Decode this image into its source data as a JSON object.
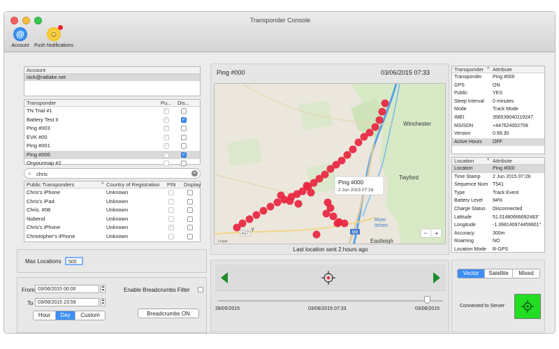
{
  "window": {
    "title": "Transponder Console"
  },
  "toolbar": {
    "account_label": "Account",
    "push_label": "Push Notifications"
  },
  "account": {
    "header": "Account",
    "email": "nick@ratlake.net"
  },
  "transponders": {
    "headers": [
      "Transponder",
      "Pu...",
      "Dis..."
    ],
    "rows": [
      {
        "name": "TN Trial #1",
        "public": true,
        "display": false
      },
      {
        "name": "Battery Test II",
        "public": true,
        "display": true
      },
      {
        "name": "Ping #003",
        "public": true,
        "display": false
      },
      {
        "name": "EVK #00",
        "public": true,
        "display": false
      },
      {
        "name": "Ping #001",
        "public": true,
        "display": false
      },
      {
        "name": "Ping #000",
        "public": true,
        "display": true,
        "selected": true
      },
      {
        "name": "Onyourmap #2",
        "public": false,
        "display": false
      }
    ]
  },
  "search": {
    "value": "chris"
  },
  "public": {
    "headers": [
      "Public Transponders",
      "Country of Registration",
      "PIN",
      "Display"
    ],
    "rows": [
      {
        "name": "Chris's iPhone",
        "country": "Unknown",
        "pin": false
      },
      {
        "name": "Chris's iPad",
        "country": "Unknown",
        "pin": false
      },
      {
        "name": "Chris. #08",
        "country": "Unknown",
        "pin": false
      },
      {
        "name": "Nobend",
        "country": "Unknown",
        "pin": false
      },
      {
        "name": "Chris's iPhone",
        "country": "Unknown",
        "pin": true
      },
      {
        "name": "Christopher's iPhone",
        "country": "Unknown",
        "pin": false
      }
    ]
  },
  "max_locations": {
    "label": "Max Locations",
    "value": "500"
  },
  "range": {
    "from_label": "From",
    "from_value": "03/06/2015 00:00",
    "to_label": "To",
    "to_value": "03/06/2015 23:59",
    "segments": [
      "Hour",
      "Day",
      "Custom"
    ],
    "active": "Day"
  },
  "breadcrumbs": {
    "filter_label": "Enable Breadcrumbs Filter",
    "button_label": "Breadcrumbs ON"
  },
  "map": {
    "title": "Ping #000",
    "datetime": "03/06/2015 07:33",
    "popup_title": "Ping #000",
    "popup_sub": "2 Jun 2015 07:28",
    "status": "Last location sent 2 hours ago",
    "places": {
      "winchester": "Winchester",
      "twyford": "Twyford",
      "river": "River",
      "itchen": "Itchen",
      "eastleigh": "Eastleigh",
      "a27": "A27",
      "m3": "M3",
      "legal": "Legal",
      "ey": "y"
    },
    "zoom_out": "−",
    "zoom_in": "+"
  },
  "timeline": {
    "start": "28/05/2015",
    "current": "03/06/2015 07:33",
    "end": "03/06/2015",
    "position": 0.93
  },
  "transponder_attrs": {
    "headers": [
      "Transponder",
      "Attribute"
    ],
    "rows": [
      {
        "k": "Transponder",
        "v": "Ping #000"
      },
      {
        "k": "GPS",
        "v": "ON"
      },
      {
        "k": "Public",
        "v": "YES"
      },
      {
        "k": "Sleep Interval",
        "v": "0 minutes"
      },
      {
        "k": "Mode",
        "v": "Track Mode"
      },
      {
        "k": "IMEI",
        "v": "356539040119247"
      },
      {
        "k": "MSISDN",
        "v": "+447624002759"
      },
      {
        "k": "Version",
        "v": "0.99.30"
      },
      {
        "k": "Active Hours",
        "v": "OFF",
        "selected": true
      }
    ]
  },
  "location_attrs": {
    "headers": [
      "Location",
      "Attribute"
    ],
    "rows": [
      {
        "k": "Location",
        "v": "Ping #000",
        "selected": true
      },
      {
        "k": "Time Stamp",
        "v": "2 Jun 2015 07:28"
      },
      {
        "k": "Sequence Num",
        "v": "T541"
      },
      {
        "k": "Type",
        "v": "Track Event"
      },
      {
        "k": "Battery Level",
        "v": "94%"
      },
      {
        "k": "Charge Status",
        "v": "Disconnected"
      },
      {
        "k": "Latitude",
        "v": "51.01480666692483°"
      },
      {
        "k": "Longitude",
        "v": "-1.398140974459901°"
      },
      {
        "k": "Accuracy",
        "v": "300m"
      },
      {
        "k": "Roaming",
        "v": "NO"
      },
      {
        "k": "Location Mode",
        "v": "R-GPS"
      }
    ]
  },
  "maptype": {
    "segments": [
      "Vector",
      "Satellite",
      "Mixed"
    ],
    "active": "Vector"
  },
  "server": {
    "label": "Connected to Server",
    "status_color": "#22dd22"
  },
  "colors": {
    "accent": "#3d8ef5",
    "track": "#e8253f"
  }
}
